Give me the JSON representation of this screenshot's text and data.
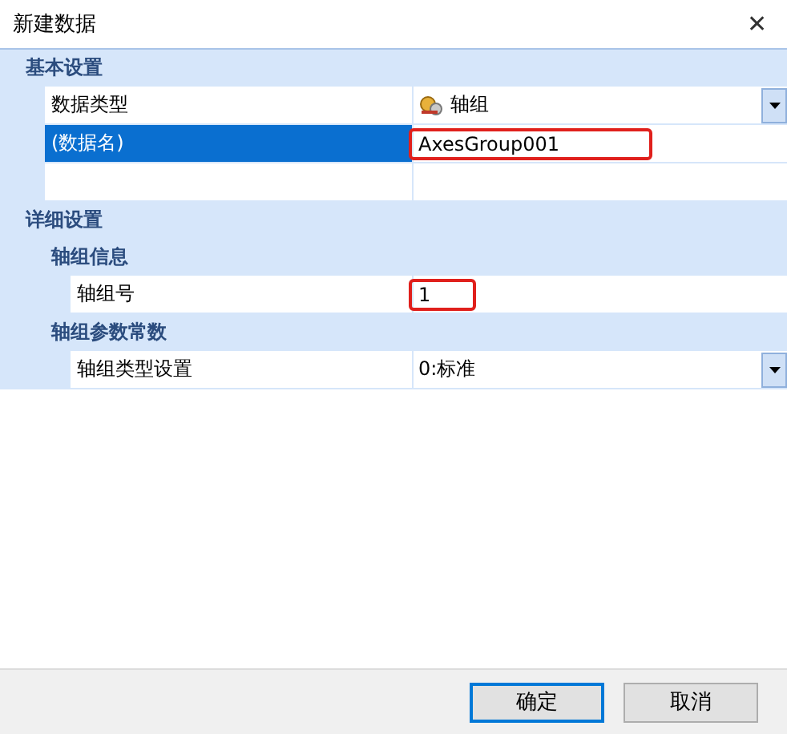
{
  "window": {
    "title": "新建数据",
    "close": "✕"
  },
  "sections": [
    {
      "title": "基本设置",
      "rows": [
        {
          "kind": "dropdown",
          "label": "数据类型",
          "value": "轴组",
          "icon": true,
          "selected": false,
          "highlighted": false
        },
        {
          "kind": "text",
          "label": "(数据名)",
          "value": "AxesGroup001",
          "selected": true,
          "highlighted": true
        },
        {
          "kind": "blank",
          "selected": false
        }
      ]
    },
    {
      "title": "详细设置",
      "children": [
        {
          "title": "轴组信息",
          "rows": [
            {
              "kind": "text",
              "label": "轴组号",
              "value": "1",
              "selected": false,
              "highlighted": true
            }
          ]
        },
        {
          "title": "轴组参数常数",
          "rows": [
            {
              "kind": "dropdown",
              "label": "轴组类型设置",
              "value": "0:标准",
              "icon": false,
              "selected": false,
              "highlighted": false
            }
          ]
        }
      ]
    }
  ],
  "buttons": [
    {
      "label": "确定",
      "focused": true
    },
    {
      "label": "取消",
      "focused": false
    }
  ]
}
